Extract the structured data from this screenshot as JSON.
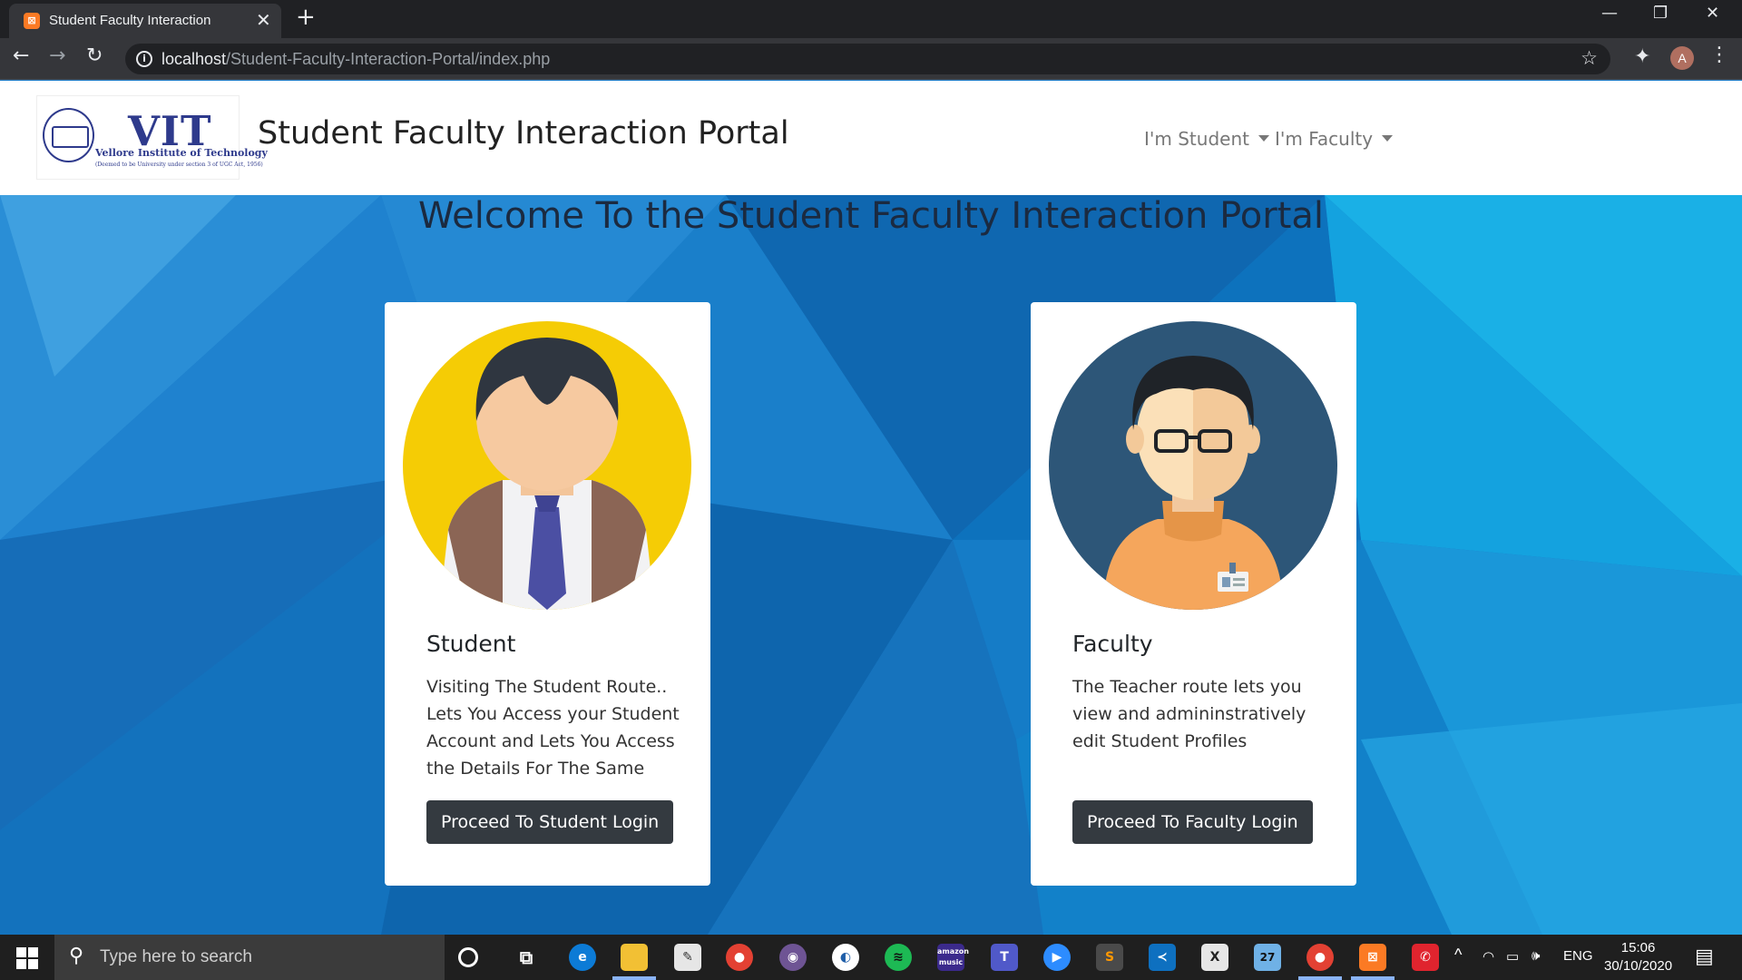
{
  "browser": {
    "tab_title": "Student Faculty Interaction",
    "tab_close": "✕",
    "new_tab": "+",
    "url_host": "localhost",
    "url_path": "/Student-Faculty-Interaction-Portal/index.php",
    "profile_initial": "A"
  },
  "navbar": {
    "logo_text": "VIT",
    "logo_subtitle": "Vellore Institute of Technology",
    "logo_fine_print": "(Deemed to be University under section 3 of UGC Act, 1956)",
    "brand": "Student Faculty Interaction Portal",
    "student_dropdown": "I'm Student",
    "faculty_dropdown": "I'm Faculty"
  },
  "page": {
    "welcome": "Welcome To the Student Faculty Interaction Portal"
  },
  "cards": {
    "student": {
      "title": "Student",
      "text": "Visiting The Student Route.. Lets You Access your Student Account and Lets You Access the Details For The Same",
      "button": "Proceed To Student Login"
    },
    "faculty": {
      "title": "Faculty",
      "text": "The Teacher route lets you view and admininstratively edit Student Profiles",
      "button": "Proceed To Faculty Login"
    }
  },
  "taskbar": {
    "search_placeholder": "Type here to search",
    "language": "ENG",
    "time": "15:06",
    "date": "30/10/2020",
    "badge_count": "27"
  },
  "colors": {
    "background_blue": "#1a78c4",
    "dark_button": "#343a40",
    "student_avatar": "#f5cc05",
    "faculty_avatar": "#2d5678"
  }
}
